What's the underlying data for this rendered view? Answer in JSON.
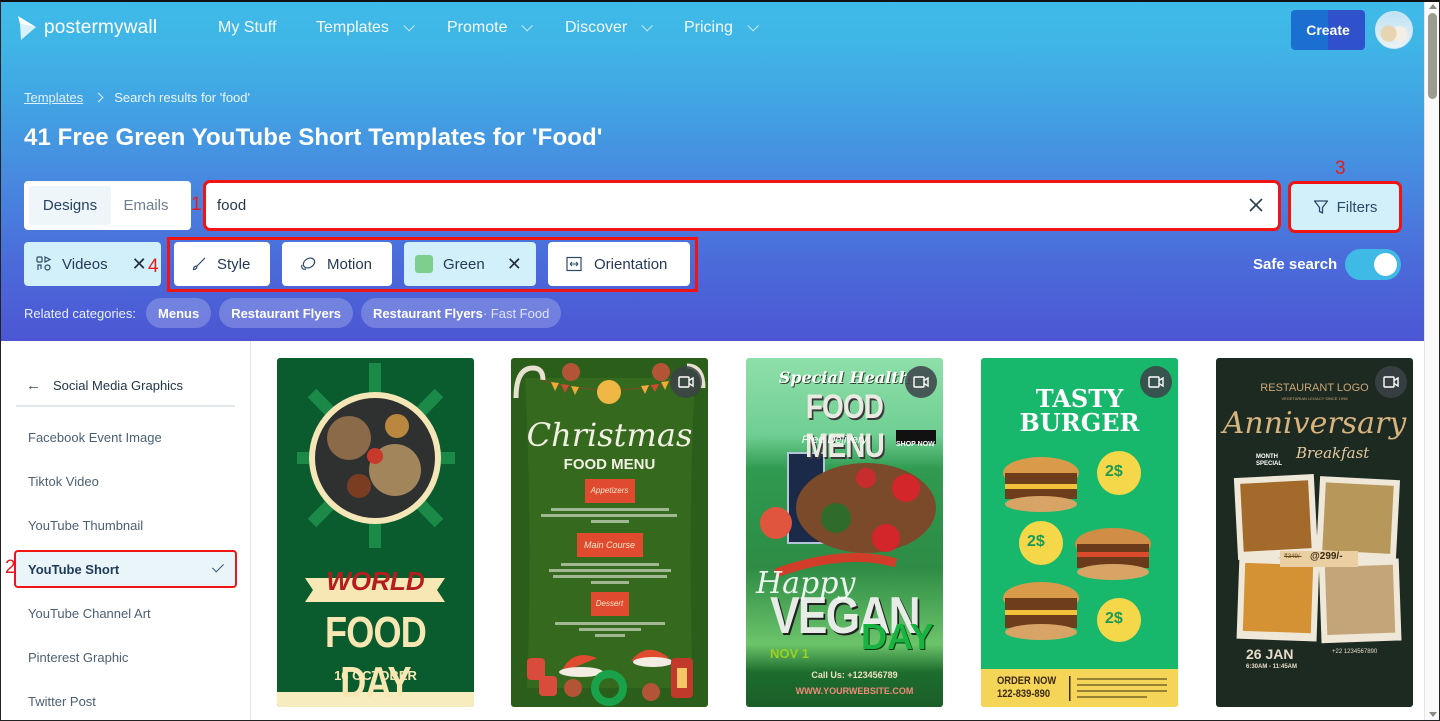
{
  "nav": {
    "brand": "postermywall",
    "items": [
      {
        "label": "My Stuff",
        "has_dropdown": false
      },
      {
        "label": "Templates",
        "has_dropdown": true
      },
      {
        "label": "Promote",
        "has_dropdown": true
      },
      {
        "label": "Discover",
        "has_dropdown": true
      },
      {
        "label": "Pricing",
        "has_dropdown": true
      }
    ],
    "create_label": "Create"
  },
  "breadcrumb": {
    "link": "Templates",
    "current": "Search results for 'food'"
  },
  "page_title": "41 Free Green YouTube Short Templates for 'Food'",
  "search": {
    "tabs": [
      {
        "label": "Designs",
        "active": true
      },
      {
        "label": "Emails",
        "active": false
      }
    ],
    "value": "food",
    "filters_label": "Filters"
  },
  "chips": {
    "videos": "Videos",
    "style": "Style",
    "motion": "Motion",
    "green": "Green",
    "green_color": "#7ecf8d",
    "orientation": "Orientation",
    "remove_glyph": "✕"
  },
  "safe_search": {
    "label": "Safe search",
    "enabled": true
  },
  "related": {
    "label": "Related categories:",
    "items": [
      {
        "label": "Menus",
        "sub": ""
      },
      {
        "label": "Restaurant Flyers",
        "sub": ""
      },
      {
        "label": "Restaurant Flyers",
        "sub": " · Fast Food"
      }
    ]
  },
  "sidebar": {
    "heading": "Social Media Graphics",
    "items": [
      {
        "label": "Facebook Event Image",
        "selected": false
      },
      {
        "label": "Tiktok Video",
        "selected": false
      },
      {
        "label": "YouTube Thumbnail",
        "selected": false
      },
      {
        "label": "YouTube Short",
        "selected": true
      },
      {
        "label": "YouTube Channel Art",
        "selected": false
      },
      {
        "label": "Pinterest Graphic",
        "selected": false
      },
      {
        "label": "Twitter Post",
        "selected": false
      }
    ]
  },
  "annotations": [
    "1",
    "2",
    "3",
    "4"
  ],
  "templates": [
    {
      "title": "WORLD",
      "subtitle": "FOOD DAY",
      "date": "16 OCTOBER",
      "video": false
    },
    {
      "title": "Christmas",
      "subtitle": "FOOD MENU",
      "sections": [
        "Appetizers",
        "Main Course",
        "Dessert"
      ],
      "video": true
    },
    {
      "title": "Special Health",
      "subtitle": "FOOD MENU",
      "tagline": "Free Delivery",
      "cta": "SHOP NOW",
      "big1": "VEGAN",
      "big2": "DAY",
      "script": "Happy",
      "date": "NOV 1",
      "contact": "Call Us: +123456789",
      "website": "WWW.YOURWEBSITE.COM",
      "video": true
    },
    {
      "title": "TASTY",
      "subtitle": "BURGER",
      "price": "2$",
      "order": "ORDER NOW",
      "phone": "122-839-890",
      "video": true
    },
    {
      "brand": "RESTAURANT LOGO",
      "brand_sub": "VEGETARIAN LEGACY SINCE 1996",
      "title": "Anniversary",
      "subtitle": "Breakfast",
      "tag": "MONTH SPECIAL",
      "old_price": "₹349/-",
      "price": "@299/-",
      "date": "26 JAN",
      "time": "6:30AM - 11:45AM",
      "phone": "+22 1234567890",
      "video": true
    }
  ]
}
